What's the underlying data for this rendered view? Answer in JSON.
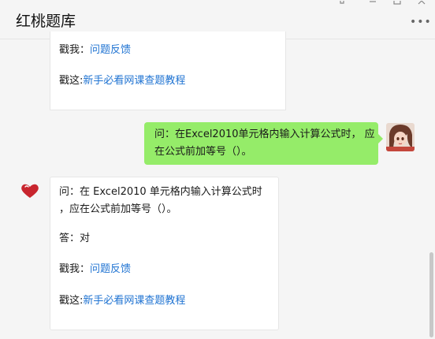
{
  "window": {
    "title": "红桃题库",
    "more_icon": "more-dots-icon",
    "controls": [
      "pin-icon",
      "minimize-icon",
      "maximize-icon",
      "close-icon"
    ]
  },
  "messages": {
    "first": {
      "feedback_prefix": "戳我：",
      "feedback_link": "问题反馈",
      "tutorial_prefix": "戳这:",
      "tutorial_link": "新手必看网课查题教程"
    },
    "self": {
      "line1": "问：在Excel2010单元格内输入计算公式时，",
      "line2": "应在公式前加等号（）。"
    },
    "bot": {
      "line1": "问：在 Excel2010 单元格内输入计算公式时",
      "line2": "，应在公式前加等号（）。",
      "answer": "答：对",
      "feedback_prefix": "戳我：",
      "feedback_link": "问题反馈",
      "tutorial_prefix": "戳这:",
      "tutorial_link": "新手必看网课查题教程"
    }
  },
  "colors": {
    "self_bubble": "#95ec69",
    "link": "#1f73d2",
    "background": "#f5f5f5"
  }
}
